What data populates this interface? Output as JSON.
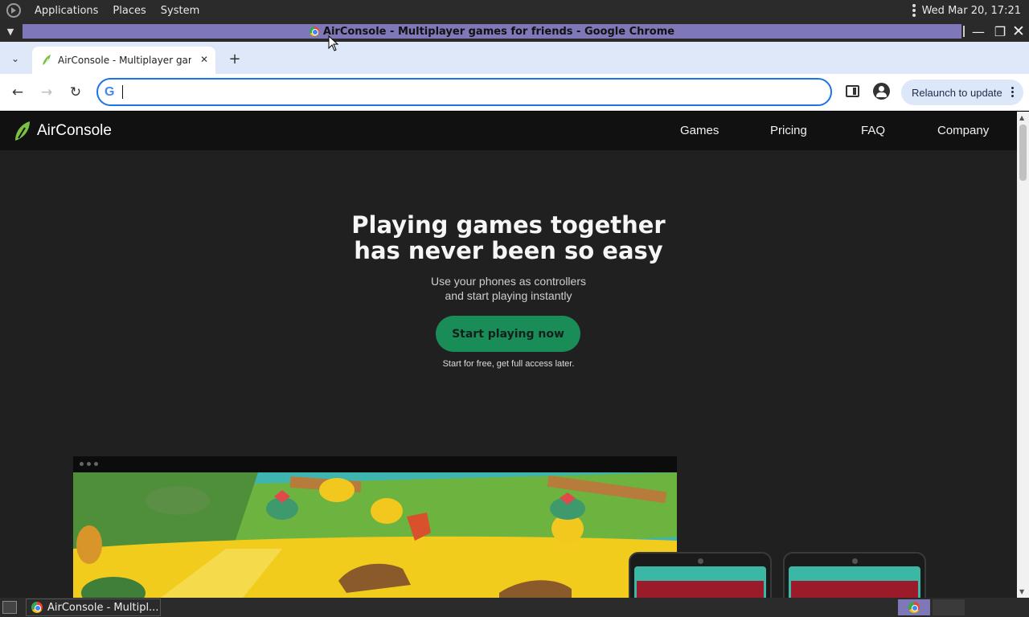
{
  "top_panel": {
    "menus": [
      "Applications",
      "Places",
      "System"
    ],
    "clock": "Wed Mar 20, 17:21"
  },
  "window": {
    "title": "AirConsole - Multiplayer games for friends - Google Chrome"
  },
  "browser": {
    "tab": {
      "title": "AirConsole - Multiplayer games for friends"
    },
    "omnibox": {
      "value": "",
      "placeholder": ""
    },
    "relaunch_label": "Relaunch to update"
  },
  "site": {
    "brand": "AirConsole",
    "nav": [
      "Games",
      "Pricing",
      "FAQ",
      "Company"
    ],
    "hero": {
      "title_line1": "Playing games together",
      "title_line2": "has never been so easy",
      "subtitle_line1": "Use your phones as controllers",
      "subtitle_line2": "and start playing instantly",
      "cta": "Start playing now",
      "cta_note": "Start for free, get full access later."
    },
    "accent_color": "#1a8c58"
  },
  "taskbar": {
    "task_label": "AirConsole - Multipl..."
  },
  "icons": {
    "window_menu": "chevron-down-icon",
    "minimize": "minimize-icon",
    "maximize": "maximize-icon",
    "close": "close-icon",
    "back": "back-arrow-icon",
    "forward": "forward-arrow-icon",
    "reload": "reload-icon"
  }
}
